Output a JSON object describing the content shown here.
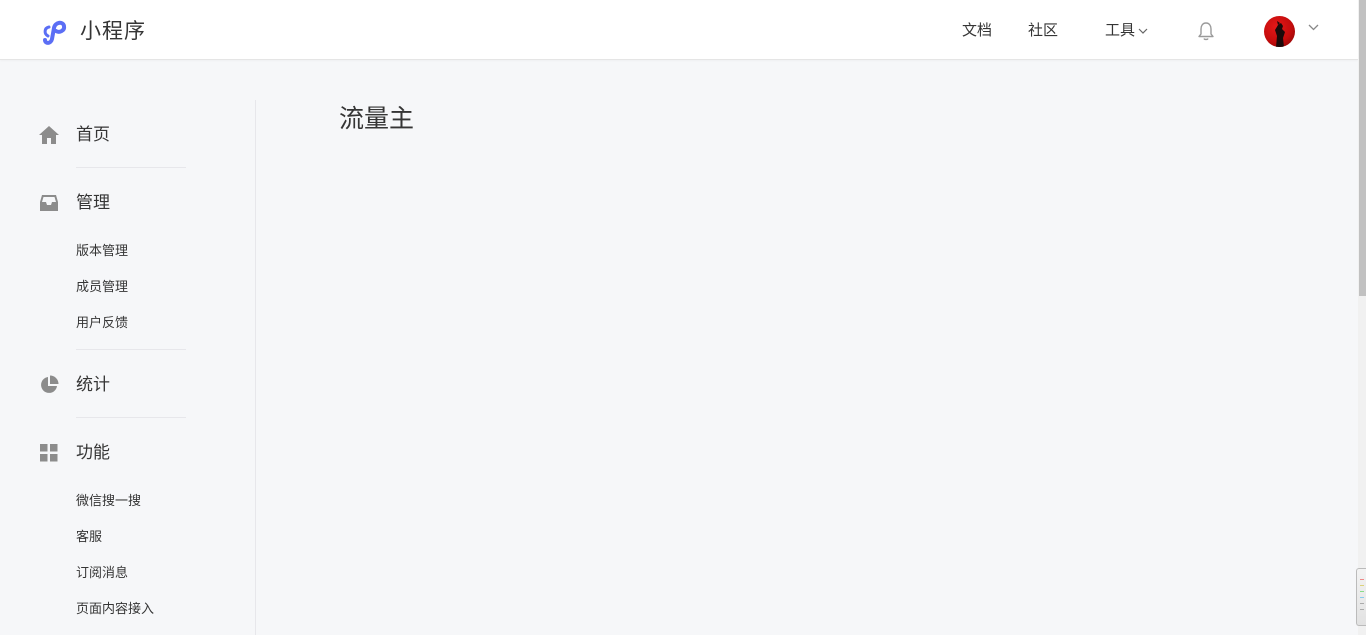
{
  "header": {
    "brand": "小程序",
    "brand_color": "#5b6ef5",
    "nav": {
      "docs": "文档",
      "community": "社区",
      "tools": "工具"
    },
    "icons": {
      "notification": "bell-icon",
      "account_menu": "chevron-down-icon"
    }
  },
  "sidebar": {
    "groups": [
      {
        "label": "首页",
        "icon": "home-icon"
      },
      {
        "label": "管理",
        "icon": "inbox-icon",
        "items": [
          "版本管理",
          "成员管理",
          "用户反馈"
        ]
      },
      {
        "label": "统计",
        "icon": "pie-chart-icon"
      },
      {
        "label": "功能",
        "icon": "grid-icon",
        "items": [
          "微信搜一搜",
          "客服",
          "订阅消息",
          "页面内容接入"
        ]
      }
    ]
  },
  "main": {
    "title": "流量主"
  },
  "colors": {
    "background": "#f6f7f9",
    "text": "#353535",
    "icon_gray": "#8c8c8c",
    "avatar_red": "#d01010"
  }
}
